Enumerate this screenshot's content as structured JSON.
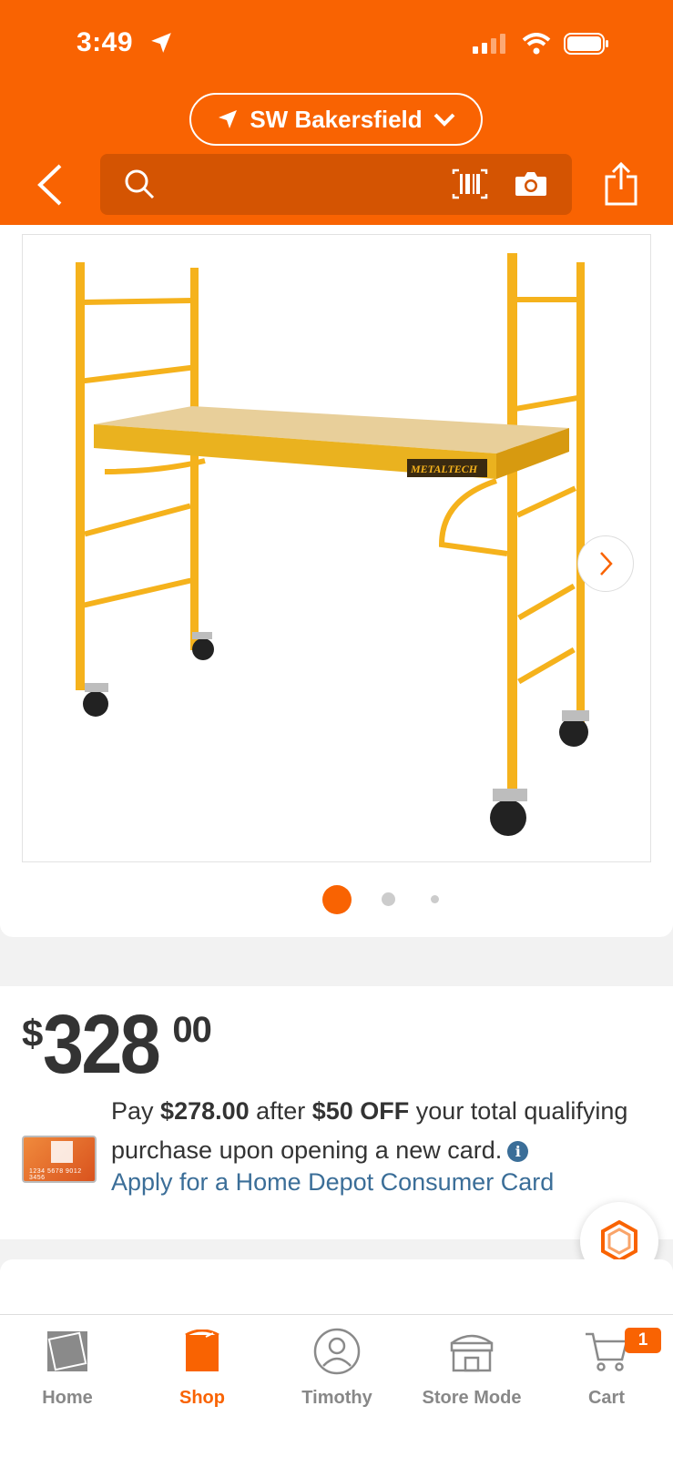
{
  "status_bar": {
    "time": "3:49"
  },
  "header": {
    "store_name": "SW Bakersfield",
    "search_placeholder": ""
  },
  "product": {
    "image_alt": "Yellow rolling scaffold with wood platform and caster wheels",
    "brand_mark": "METALTECH",
    "image_count": 3,
    "active_image": 1
  },
  "price": {
    "currency": "$",
    "dollars": "328",
    "cents": "00"
  },
  "offer": {
    "card_number": "1234 5678 9012 3456",
    "prefix": "Pay",
    "discounted_price": "$278.00",
    "middle": "after",
    "discount": "$50 OFF",
    "suffix": "your total qualifying purchase upon opening a new card.",
    "apply_link": "Apply for a Home Depot Consumer Card"
  },
  "tabbar": {
    "tabs": [
      {
        "label": "Home",
        "icon": "home-depot-logo-icon"
      },
      {
        "label": "Shop",
        "icon": "shop-bucket-icon"
      },
      {
        "label": "Timothy",
        "icon": "user-icon"
      },
      {
        "label": "Store Mode",
        "icon": "store-icon"
      },
      {
        "label": "Cart",
        "icon": "cart-icon"
      }
    ],
    "active": "Shop",
    "cart_count": "1"
  },
  "colors": {
    "brand_orange": "#f96302",
    "link_blue": "#3b6e98",
    "scaffold_yellow": "#f5b21c"
  }
}
